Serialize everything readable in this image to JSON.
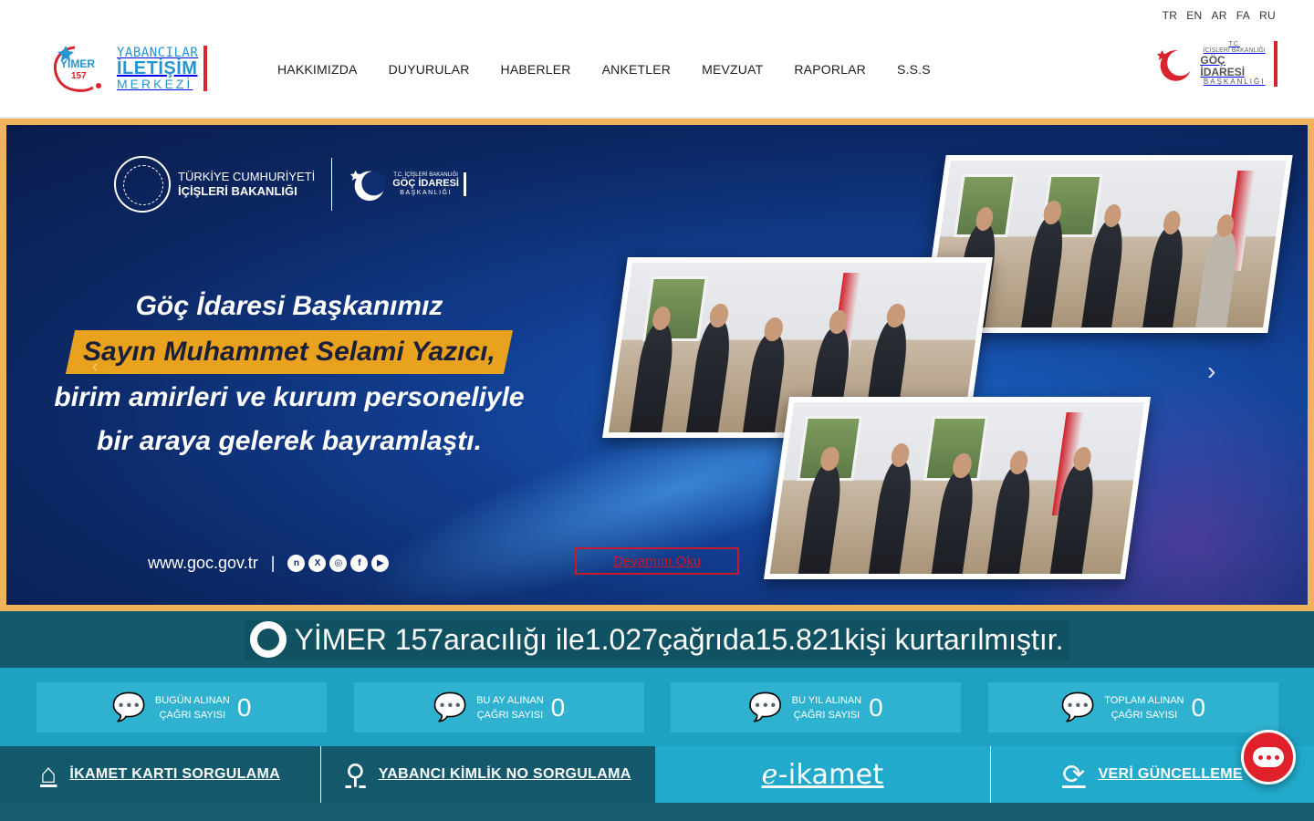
{
  "header": {
    "languages": [
      "TR",
      "EN",
      "AR",
      "FA",
      "RU"
    ],
    "logo_left": {
      "badge_top": "YİMER",
      "badge_bottom": "157",
      "line1": "YABANCILAR",
      "line2": "İLETİŞİM",
      "line3": "MERKEZİ"
    },
    "nav": [
      "HAKKIMIZDA",
      "DUYURULAR",
      "HABERLER",
      "ANKETLER",
      "MEVZUAT",
      "RAPORLAR",
      "S.S.S"
    ],
    "logo_right": {
      "line1": "T.C.",
      "line2": "İÇİŞLERİ BAKANLIĞI",
      "line3": "GÖÇ İDARESİ",
      "line4": "BAŞKANLIĞI"
    }
  },
  "slide": {
    "ministry_line1": "TÜRKİYE CUMHURİYETİ",
    "ministry_line2": "İÇİŞLERİ BAKANLIĞI",
    "goc_line1": "T.C. İÇİŞLERİ BAKANLIĞI",
    "goc_line2": "GÖÇ İDARESİ",
    "goc_line3": "BAŞKANLIĞI",
    "headline_1": "Göç İdaresi Başkanımız",
    "headline_2": "Sayın Muhammet Selami Yazıcı,",
    "headline_3": "birim amirleri ve kurum personeliyle",
    "headline_4": "bir araya gelerek bayramlaştı.",
    "website": "www.goc.gov.tr",
    "separator": "|",
    "social_icons": [
      "nsosyal-icon",
      "x-icon",
      "instagram-icon",
      "facebook-icon",
      "youtube-icon"
    ],
    "read_more": "Devamını Oku",
    "next_arrow": "›",
    "prev_arrow": "‹"
  },
  "rescue": {
    "prefix": "YİMER 157",
    "mid": " aracılığı ile ",
    "calls": "1.027",
    "mid2": " çağrıda ",
    "people": "15.821",
    "suffix": " kişi kurtarılmıştır."
  },
  "counters": [
    {
      "label_1": "BUGÜN ALINAN",
      "label_2": "ÇAĞRI SAYISI",
      "value": "0"
    },
    {
      "label_1": "BU AY ALINAN",
      "label_2": "ÇAĞRI SAYISI",
      "value": "0"
    },
    {
      "label_1": "BU YIL ALINAN",
      "label_2": "ÇAĞRI SAYISI",
      "value": "0"
    },
    {
      "label_1": "TOPLAM ALINAN",
      "label_2": "ÇAĞRI SAYISI",
      "value": "0"
    }
  ],
  "quick_links": {
    "residence": "İKAMET KARTI SORGULAMA",
    "foreign_id": "YABANCI KİMLİK NO SORGULAMA",
    "e_ikamet": "-ikamet",
    "update": "VERİ GÜNCELLEME"
  },
  "colors": {
    "brand_blue": "#2596d1",
    "brand_red": "#d9232d",
    "teal_dark": "#13596b",
    "teal_light": "#1ea1c3",
    "slider_frame": "#f0b35b",
    "highlight": "#e8a21e"
  }
}
